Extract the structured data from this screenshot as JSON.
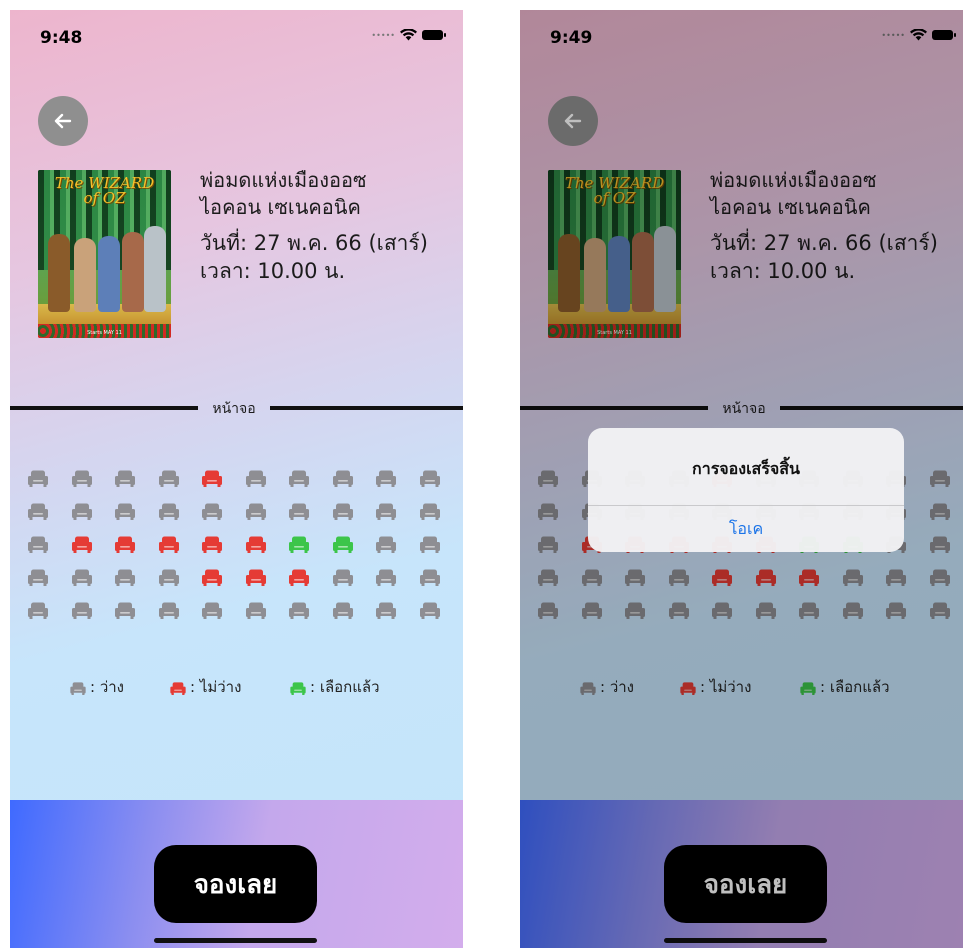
{
  "screens": [
    {
      "status_time": "9:48",
      "dimmed": false,
      "alert": null
    },
    {
      "status_time": "9:49",
      "dimmed": true,
      "alert": {
        "title": "การจองเสร็จสิ้น",
        "button": "โอเค"
      }
    }
  ],
  "movie": {
    "title": "พ่อมดแห่งเมืองออซ",
    "cinema": "ไอคอน เซเนคอนิค",
    "date": "วันที่: 27 พ.ค. 66 (เสาร์)",
    "time": "เวลา: 10.00 น.",
    "poster_title_line1": "The WIZARD",
    "poster_title_line2": "of OZ",
    "poster_date": "Starts MAY 11"
  },
  "screen_label": "หน้าจอ",
  "seat_map": [
    [
      "free",
      "free",
      "free",
      "free",
      "taken",
      "free",
      "free",
      "free",
      "free",
      "free"
    ],
    [
      "free",
      "free",
      "free",
      "free",
      "free",
      "free",
      "free",
      "free",
      "free",
      "free"
    ],
    [
      "free",
      "taken",
      "taken",
      "taken",
      "taken",
      "taken",
      "selected",
      "selected",
      "free",
      "free"
    ],
    [
      "free",
      "free",
      "free",
      "free",
      "taken",
      "taken",
      "taken",
      "free",
      "free",
      "free"
    ],
    [
      "free",
      "free",
      "free",
      "free",
      "free",
      "free",
      "free",
      "free",
      "free",
      "free"
    ]
  ],
  "legend": {
    "free": ": ว่าง",
    "taken": ": ไม่ว่าง",
    "selected": ": เลือกแล้ว"
  },
  "colors": {
    "free": "#8e8e93",
    "taken": "#e53b35",
    "selected": "#3cc54a"
  },
  "book_button": "จองเลย",
  "icons": {
    "back": "arrow-left-icon",
    "seat": "seat-icon",
    "wifi": "wifi-icon",
    "battery": "battery-icon"
  }
}
